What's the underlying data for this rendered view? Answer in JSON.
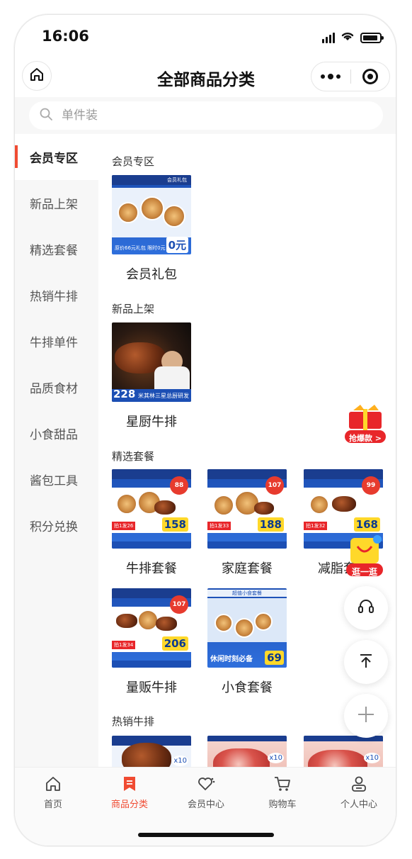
{
  "status_bar": {
    "time": "16:06"
  },
  "nav": {
    "title": "全部商品分类"
  },
  "search": {
    "placeholder": "单件装"
  },
  "sidebar": {
    "items": [
      {
        "label": "会员专区",
        "active": true
      },
      {
        "label": "新品上架",
        "active": false
      },
      {
        "label": "精选套餐",
        "active": false
      },
      {
        "label": "热销牛排",
        "active": false
      },
      {
        "label": "牛排单件",
        "active": false
      },
      {
        "label": "品质食材",
        "active": false
      },
      {
        "label": "小食甜品",
        "active": false
      },
      {
        "label": "酱包工具",
        "active": false
      },
      {
        "label": "积分兑换",
        "active": false
      }
    ]
  },
  "sections": [
    {
      "title": "会员专区",
      "products": [
        {
          "name": "会员礼包",
          "thumb": {
            "banner": "会员礼包",
            "footer": "原价66元礼包 限时0元",
            "price": "0元"
          }
        }
      ]
    },
    {
      "title": "新品上架",
      "products": [
        {
          "name": "星厨牛排",
          "thumb": {
            "price": "228",
            "caption": "米其林三星总厨研发"
          }
        }
      ]
    },
    {
      "title": "精选套餐",
      "products": [
        {
          "name": "牛排套餐",
          "thumb": {
            "badge": "88",
            "promo": "拍1发26",
            "price": "158"
          }
        },
        {
          "name": "家庭套餐",
          "thumb": {
            "badge": "107",
            "promo": "拍1发33",
            "price": "188"
          }
        },
        {
          "name": "减脂套餐",
          "thumb": {
            "badge": "99",
            "promo": "拍1发32",
            "price": "168"
          }
        },
        {
          "name": "量贩牛排",
          "thumb": {
            "badge": "107",
            "promo": "拍1发34",
            "price": "206"
          }
        },
        {
          "name": "小食套餐",
          "thumb": {
            "top": "超值小食套餐",
            "caption": "休闲时刻必备",
            "price": "69"
          }
        }
      ]
    },
    {
      "title": "热销牛排",
      "products": [
        {
          "thumb": {
            "qty": "x10"
          }
        },
        {
          "thumb": {
            "qty": "x10"
          }
        },
        {
          "thumb": {
            "qty": "x10"
          }
        }
      ]
    }
  ],
  "floating": {
    "promo_label": "抢爆款 >",
    "shop_label": "逛一逛"
  },
  "tabbar": {
    "items": [
      {
        "label": "首页",
        "icon": "home-icon",
        "active": false
      },
      {
        "label": "商品分类",
        "icon": "bookmark-icon",
        "active": true
      },
      {
        "label": "会员中心",
        "icon": "heart-icon",
        "active": false
      },
      {
        "label": "购物车",
        "icon": "cart-icon",
        "active": false
      },
      {
        "label": "个人中心",
        "icon": "user-icon",
        "active": false
      }
    ]
  },
  "colors": {
    "accent": "#f04b32",
    "brand_blue": "#1c4fb4",
    "price_yellow": "#ffd82a"
  }
}
